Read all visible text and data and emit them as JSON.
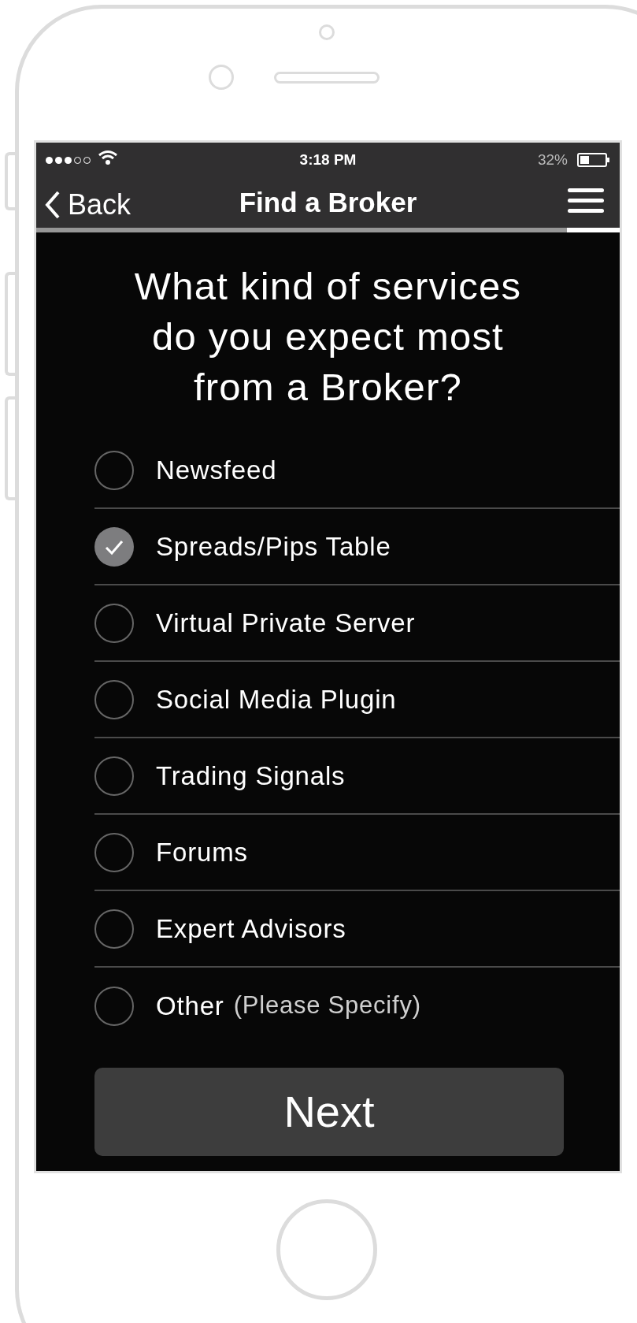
{
  "status_bar": {
    "time": "3:18 PM",
    "battery": "32%"
  },
  "nav_bar": {
    "back": "Back",
    "title": "Find a Broker"
  },
  "progress": {
    "level": 0.91
  },
  "question": "What kind of services do you expect most from a Broker?",
  "options": [
    {
      "label": "Newsfeed",
      "selected": false
    },
    {
      "label": "Spreads/Pips Table",
      "selected": true
    },
    {
      "label": "Virtual Private Server",
      "selected": false
    },
    {
      "label": "Social Media Plugin",
      "selected": false
    },
    {
      "label": "Trading Signals",
      "selected": false
    },
    {
      "label": "Forums",
      "selected": false
    },
    {
      "label": "Expert Advisors",
      "selected": false
    },
    {
      "label": "Other",
      "note": "(Please Specify)",
      "selected": false
    }
  ],
  "next_button": "Next"
}
